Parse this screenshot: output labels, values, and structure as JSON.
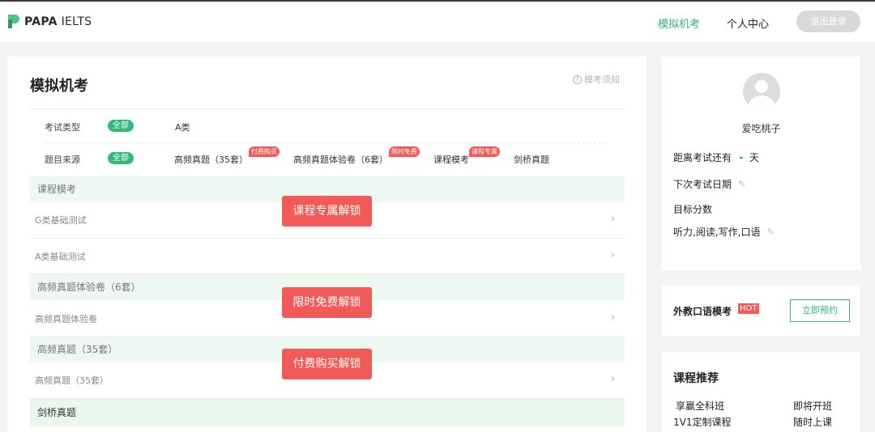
{
  "header": {
    "brand_bold": "PAPA",
    "brand_rest": " IELTS",
    "nav_mock": "模拟机考",
    "nav_center": "个人中心",
    "logout": "退出登录",
    "accent": "#2fb574"
  },
  "main": {
    "title": "模拟机考",
    "notice": "模考须知",
    "filters": {
      "type_label": "考试类型",
      "type_all": "全部",
      "type_a": "A类",
      "source_label": "题目来源",
      "source_all": "全部",
      "sources": [
        {
          "label": "高频真题（35套）",
          "tag": "付费购买"
        },
        {
          "label": "高频真题体验卷（6套）",
          "tag": "限时免费"
        },
        {
          "label": "课程模考",
          "tag": "课程专属"
        },
        {
          "label": "剑桥真题",
          "tag": ""
        }
      ]
    },
    "sections": [
      {
        "title": "课程模考",
        "items": [
          "G类基础测试",
          "A类基础测试"
        ],
        "unlock": "课程专属解锁"
      },
      {
        "title": "高频真题体验卷（6套）",
        "items": [
          "高频真题体验卷"
        ],
        "unlock": "限时免费解锁"
      },
      {
        "title": "高频真题（35套）",
        "items": [
          "高频真题（35套）"
        ],
        "unlock": "付费购买解锁"
      },
      {
        "title": "剑桥真题",
        "items": [],
        "unlock": ""
      }
    ],
    "unlock_color": "#f25a58"
  },
  "profile": {
    "username": "爱吃桃子",
    "countdown_label": "距离考试还有",
    "countdown_unit": "天",
    "next_exam_label": "下次考试日期",
    "target_label": "目标分数",
    "skills": "听力,阅读,写作,口语"
  },
  "oral": {
    "title": "外教口语模考",
    "hot": "HOT",
    "book": "立即预约"
  },
  "recommend": {
    "title": "课程推荐",
    "items": [
      {
        "name": "享赢全科班",
        "status": "即将开班"
      },
      {
        "name": "1V1定制课程",
        "status": "随时上课"
      }
    ]
  },
  "icons": [
    "logo-icon",
    "question-circle-icon",
    "chevron-right-icon",
    "avatar-icon",
    "pencil-icon"
  ]
}
